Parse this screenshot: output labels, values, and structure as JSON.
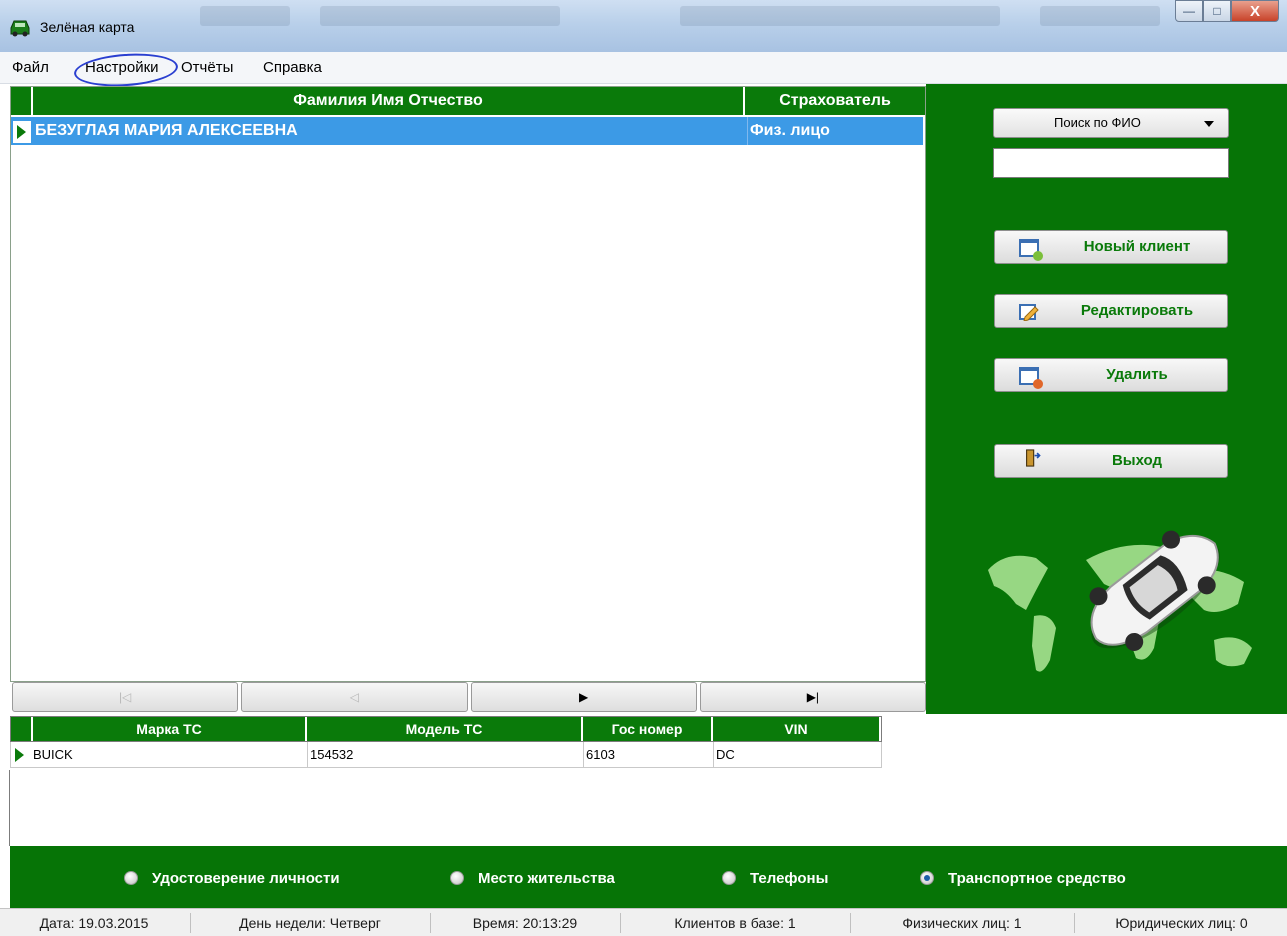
{
  "window": {
    "title": "Зелёная карта",
    "controls": {
      "minimize": "—",
      "maximize": "□",
      "close": "X"
    }
  },
  "menu": {
    "items": [
      "Файл",
      "Настройки",
      "Отчёты",
      "Справка"
    ]
  },
  "clients_grid": {
    "columns": [
      "Фамилия Имя Отчество",
      "Страхователь"
    ],
    "rows": [
      {
        "fio": "БЕЗУГЛАЯ МАРИЯ АЛЕКСЕЕВНА",
        "insurer": "Физ. лицо",
        "selected": true
      }
    ]
  },
  "navigator": {
    "first": "|◁",
    "prior": "◁",
    "next": "▶",
    "last": "▶|"
  },
  "side_panel": {
    "search_mode": "Поиск по ФИО",
    "search_value": "",
    "buttons": {
      "new_client": "Новый клиент",
      "edit": "Редактировать",
      "delete": "Удалить",
      "exit": "Выход"
    }
  },
  "vehicles_grid": {
    "columns": [
      "Марка ТС",
      "Модель ТС",
      "Гос номер",
      "VIN"
    ],
    "rows": [
      {
        "brand": "BUICK",
        "model": "154532",
        "plate": "6103",
        "vin": "DC"
      }
    ]
  },
  "detail_tabs": {
    "options": [
      "Удостоверение личности",
      "Место жительства",
      "Телефоны",
      "Транспортное средство"
    ],
    "selected": "Транспортное средство"
  },
  "status": {
    "date": "Дата: 19.03.2015",
    "weekday": "День недели: Четверг",
    "time": "Время: 20:13:29",
    "clients": "Клиентов в базе: 1",
    "individuals": "Физических лиц: 1",
    "legal": "Юридических лиц: 0"
  },
  "colors": {
    "brand_green": "#067406",
    "header_green": "#0a7a0a",
    "selection_blue": "#3c9ae6",
    "button_label_green": "#0a7a0a"
  }
}
